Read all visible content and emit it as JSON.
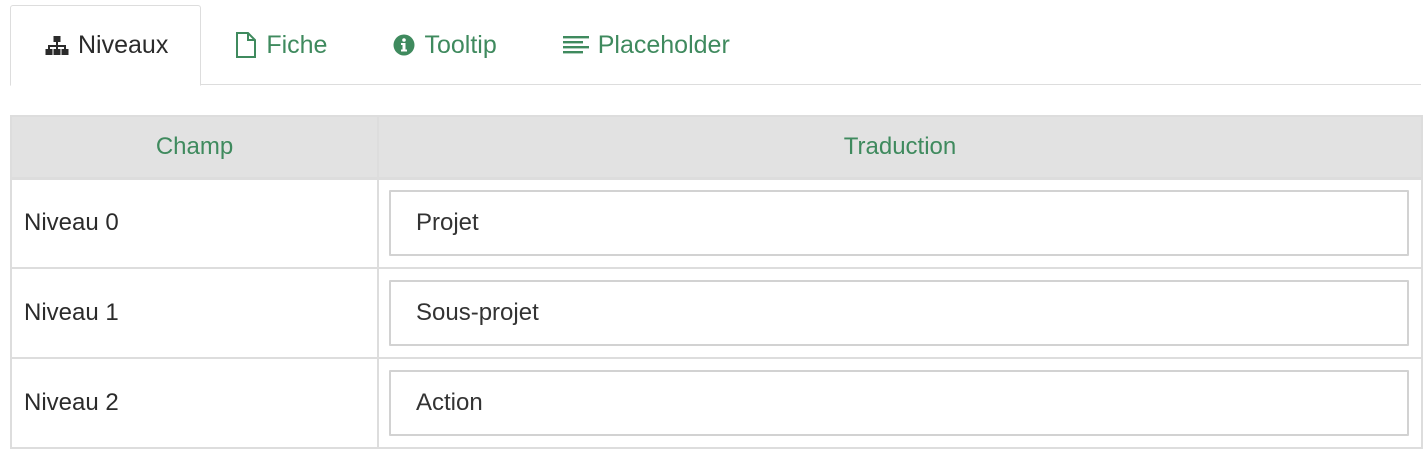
{
  "tabs": [
    {
      "label": "Niveaux",
      "icon": "sitemap-icon",
      "active": true
    },
    {
      "label": "Fiche",
      "icon": "file-icon",
      "active": false
    },
    {
      "label": "Tooltip",
      "icon": "info-circle-icon",
      "active": false
    },
    {
      "label": "Placeholder",
      "icon": "align-left-icon",
      "active": false
    }
  ],
  "table": {
    "headers": [
      "Champ",
      "Traduction"
    ],
    "rows": [
      {
        "field": "Niveau 0",
        "value": "Projet"
      },
      {
        "field": "Niveau 1",
        "value": "Sous-projet"
      },
      {
        "field": "Niveau 2",
        "value": "Action"
      }
    ]
  },
  "colors": {
    "accent": "#3f8a5e",
    "header_bg": "#e2e2e2",
    "border": "#dddddd",
    "text": "#2b2b2b"
  }
}
